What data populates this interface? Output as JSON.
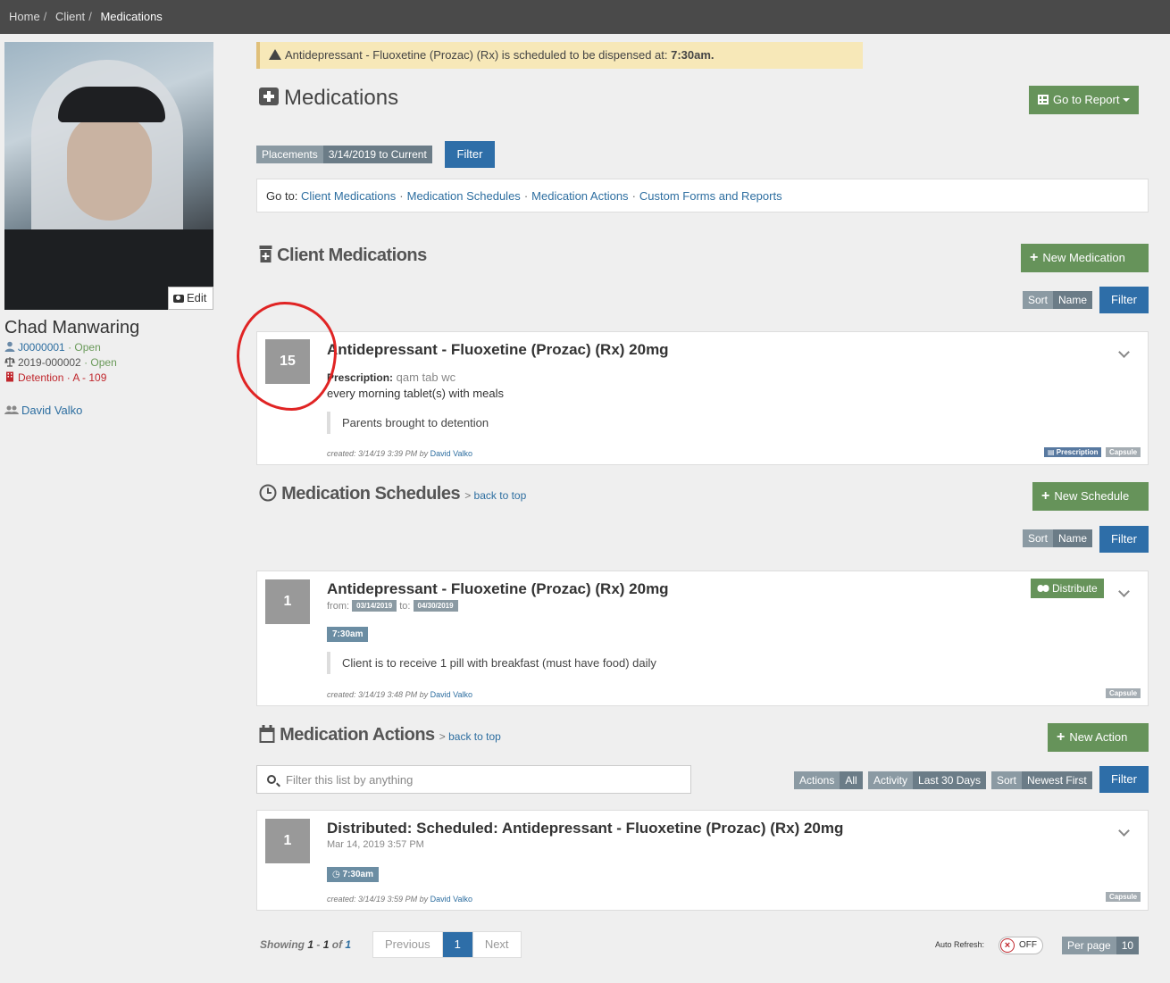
{
  "breadcrumb": [
    "Home",
    "Client",
    "Medications"
  ],
  "sidebar": {
    "edit_label": "Edit",
    "client_name": "Chad Manwaring",
    "id_number": "J0000001",
    "id_status": "· Open",
    "case_number": "2019-000002",
    "case_status": "· Open",
    "location": "Detention · A - 109",
    "worker": "David Valko"
  },
  "alert": {
    "prefix": "Antidepressant - Fluoxetine (Prozac) (Rx) is scheduled to be dispensed at: ",
    "time": "7:30am."
  },
  "page": {
    "title": "Medications",
    "report_button": "Go to Report",
    "placements_key": "Placements",
    "placements_value": "3/14/2019 to Current",
    "filter_label": "Filter"
  },
  "goto": {
    "label": "Go to:",
    "links": [
      "Client Medications",
      "Medication Schedules",
      "Medication Actions",
      "Custom Forms and Reports"
    ]
  },
  "sort_key": "Sort",
  "sort_value": "Name",
  "medications": {
    "title": "Client Medications",
    "new_button": "New Medication",
    "card": {
      "count": "15",
      "title": "Antidepressant - Fluoxetine (Prozac) (Rx) 20mg",
      "prescription_label": "Prescription:",
      "prescription_value": "qam tab wc",
      "instructions": "every morning tablet(s) with meals",
      "note": "Parents brought to detention",
      "created_prefix": "created: 3/14/19 3:39 PM by",
      "created_by": "David Valko",
      "badge_prescription": "Prescription",
      "badge_capsule": "Capsule"
    }
  },
  "schedules": {
    "title": "Medication Schedules",
    "back_prefix": ">",
    "back_link": "back to top",
    "new_button": "New Schedule",
    "card": {
      "count": "1",
      "title": "Antidepressant - Fluoxetine (Prozac) (Rx) 20mg",
      "from_label": "from:",
      "from_date": "03/14/2019",
      "to_label": "to:",
      "to_date": "04/30/2019",
      "time": "7:30am",
      "distribute_button": "Distribute",
      "note": "Client is to receive 1 pill with breakfast (must have food) daily",
      "created_prefix": "created: 3/14/19 3:48 PM by",
      "created_by": "David Valko",
      "badge_capsule": "Capsule"
    }
  },
  "actions": {
    "title": "Medication Actions",
    "back_prefix": ">",
    "back_link": "back to top",
    "new_button": "New Action",
    "search_placeholder": "Filter this list by anything",
    "filter_actions_key": "Actions",
    "filter_actions_value": "All",
    "filter_activity_key": "Activity",
    "filter_activity_value": "Last 30 Days",
    "filter_sort_key": "Sort",
    "filter_sort_value": "Newest First",
    "card": {
      "count": "1",
      "title": "Distributed: Scheduled: Antidepressant - Fluoxetine (Prozac) (Rx) 20mg",
      "date": "Mar 14, 2019 3:57 PM",
      "time": "7:30am",
      "created_prefix": "created: 3/14/19 3:59 PM by",
      "created_by": "David Valko",
      "badge_capsule": "Capsule"
    }
  },
  "footer": {
    "showing_label": "Showing",
    "range_start": "1",
    "range_sep": "-",
    "range_end": "1",
    "of_label": "of",
    "total": "1",
    "previous": "Previous",
    "current_page": "1",
    "next": "Next",
    "auto_refresh_label": "Auto Refresh:",
    "toggle_state": "OFF",
    "per_page_label": "Per page",
    "per_page_value": "10"
  },
  "colors": {
    "green": "#66935a",
    "blue": "#2e6ea8",
    "alert_bg": "#f7e8b8",
    "annotation": "#e02424"
  }
}
